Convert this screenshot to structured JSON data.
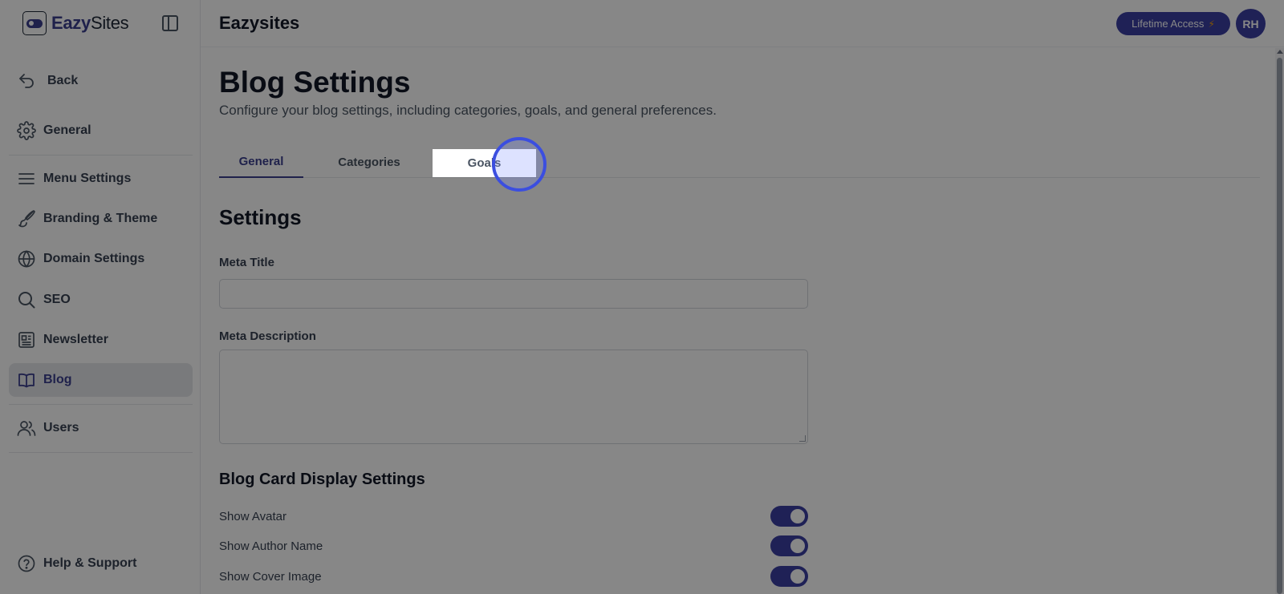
{
  "brand": {
    "name_bold": "Eazy",
    "name_regular": "Sites"
  },
  "header": {
    "title": "Eazysites",
    "lifetime_label": "Lifetime Access",
    "avatar_initials": "RH"
  },
  "sidebar": {
    "back_label": "Back",
    "items": [
      {
        "label": "General",
        "icon": "gear-icon"
      },
      {
        "label": "Menu Settings",
        "icon": "menu-icon"
      },
      {
        "label": "Branding & Theme",
        "icon": "brush-icon"
      },
      {
        "label": "Domain Settings",
        "icon": "globe-icon"
      },
      {
        "label": "SEO",
        "icon": "search-icon"
      },
      {
        "label": "Newsletter",
        "icon": "newspaper-icon"
      },
      {
        "label": "Blog",
        "icon": "book-icon",
        "active": true
      },
      {
        "label": "Users",
        "icon": "users-icon"
      }
    ],
    "help_label": "Help & Support"
  },
  "page": {
    "title": "Blog Settings",
    "subtitle": "Configure your blog settings, including categories, goals, and general preferences."
  },
  "tabs": [
    {
      "label": "General",
      "active": true
    },
    {
      "label": "Categories",
      "active": false
    },
    {
      "label": "Goals",
      "active": false
    }
  ],
  "settings": {
    "section_title": "Settings",
    "meta_title_label": "Meta Title",
    "meta_title_value": "",
    "meta_description_label": "Meta Description",
    "meta_description_value": ""
  },
  "card_display": {
    "title": "Blog Card Display Settings",
    "toggles": [
      {
        "label": "Show Avatar",
        "on": true
      },
      {
        "label": "Show Author Name",
        "on": true
      },
      {
        "label": "Show Cover Image",
        "on": true
      }
    ]
  },
  "colors": {
    "accent": "#3b3fa3",
    "bolt": "#f59e0b"
  }
}
